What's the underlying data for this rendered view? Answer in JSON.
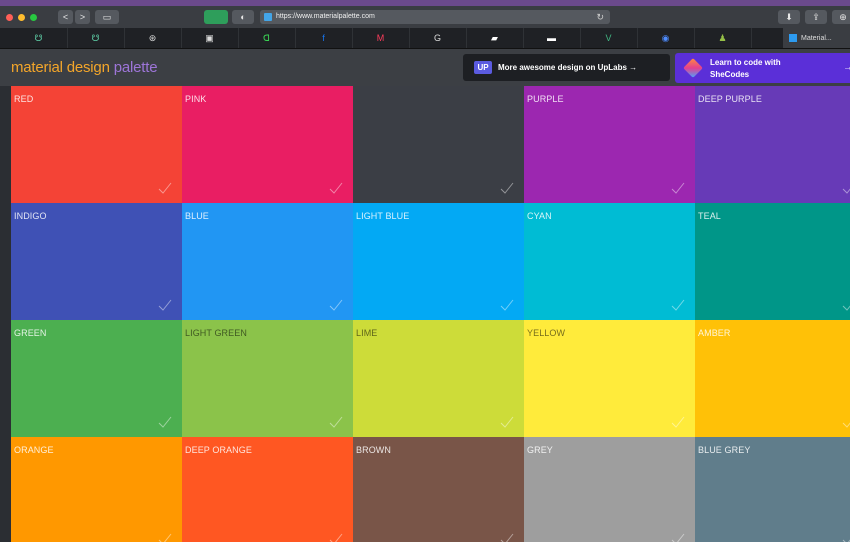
{
  "browser": {
    "url": "https://www.materialpalette.com",
    "active_tab_title": "Material...",
    "back_label": "<",
    "forward_label": ">",
    "bookmark_icons": [
      "u-icon",
      "u-icon",
      "wordpress-icon",
      "image-icon",
      "dribbble-icon",
      "facebook-icon",
      "medium-icon",
      "google-icon",
      "bookmark-icon",
      "card-icon",
      "vue-icon",
      "chrome-icon",
      "shopify-icon"
    ],
    "bookmark_glyphs": [
      "☋",
      "☋",
      "⊛",
      "▣",
      "ᗡ",
      "f",
      "M",
      "G",
      "▰",
      "▬",
      "V",
      "◉",
      "♟"
    ]
  },
  "header": {
    "logo_part1": "material design",
    "logo_part2": " palette",
    "uplabs_badge": "UP",
    "uplabs_text": "More awesome design on UpLabs →",
    "shecodes_line1": "Learn to code with",
    "shecodes_line2": "SheCodes",
    "shecodes_arrow": "→"
  },
  "colors": [
    {
      "name": "Red",
      "hex": "#f44336",
      "dark_text": false
    },
    {
      "name": "Pink",
      "hex": "#e91e63",
      "dark_text": false
    },
    {
      "name": "",
      "hex": "#3b3e45",
      "dark_text": false
    },
    {
      "name": "Purple",
      "hex": "#9c27b0",
      "dark_text": false
    },
    {
      "name": "Deep Purple",
      "hex": "#673ab7",
      "dark_text": false
    },
    {
      "name": "Indigo",
      "hex": "#3f51b5",
      "dark_text": false
    },
    {
      "name": "Blue",
      "hex": "#2196f3",
      "dark_text": false
    },
    {
      "name": "Light Blue",
      "hex": "#03a9f4",
      "dark_text": false
    },
    {
      "name": "Cyan",
      "hex": "#00bcd4",
      "dark_text": false
    },
    {
      "name": "Teal",
      "hex": "#009688",
      "dark_text": false
    },
    {
      "name": "Green",
      "hex": "#4caf50",
      "dark_text": false
    },
    {
      "name": "Light Green",
      "hex": "#8bc34a",
      "dark_text": true
    },
    {
      "name": "Lime",
      "hex": "#cddc39",
      "dark_text": true
    },
    {
      "name": "Yellow",
      "hex": "#ffeb3b",
      "dark_text": true
    },
    {
      "name": "Amber",
      "hex": "#ffc107",
      "dark_text": false
    },
    {
      "name": "Orange",
      "hex": "#ff9800",
      "dark_text": false
    },
    {
      "name": "Deep Orange",
      "hex": "#ff5722",
      "dark_text": false
    },
    {
      "name": "Brown",
      "hex": "#795548",
      "dark_text": false
    },
    {
      "name": "Grey",
      "hex": "#9e9e9e",
      "dark_text": false
    },
    {
      "name": "Blue Grey",
      "hex": "#607d8b",
      "dark_text": false
    }
  ]
}
